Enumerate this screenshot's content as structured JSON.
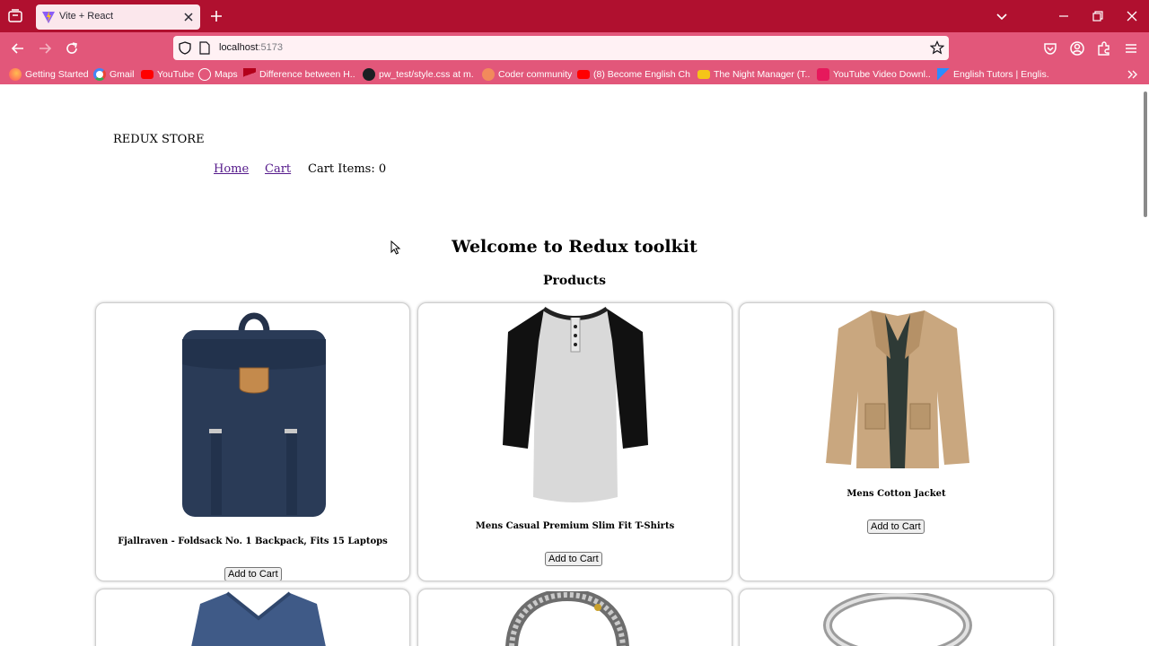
{
  "browser": {
    "tab_title": "Vite + React",
    "url_host": "localhost",
    "url_port": ":5173",
    "colors": {
      "tabbar": "#b0102f",
      "toolbar": "#e2577a"
    },
    "bookmarks": [
      {
        "label": "Getting Started",
        "icon": "firefox-icon"
      },
      {
        "label": "Gmail",
        "icon": "google-icon"
      },
      {
        "label": "YouTube",
        "icon": "youtube-icon"
      },
      {
        "label": "Maps",
        "icon": "globe-icon"
      },
      {
        "label": "Difference between H...",
        "icon": "vue-icon"
      },
      {
        "label": "pw_test/style.css at m...",
        "icon": "github-icon"
      },
      {
        "label": "Coder community",
        "icon": "community-icon"
      },
      {
        "label": "(8) Become English Ch...",
        "icon": "youtube-icon"
      },
      {
        "label": "The Night Manager (T...",
        "icon": "imdb-icon"
      },
      {
        "label": "YouTube Video Downl...",
        "icon": "downloader-icon"
      },
      {
        "label": "English Tutors | Englis...",
        "icon": "tutor-icon"
      }
    ]
  },
  "page": {
    "brand": "REDUX STORE",
    "nav": {
      "home": "Home",
      "cart": "Cart",
      "cart_items": "Cart Items: 0"
    },
    "heading": "Welcome to Redux toolkit",
    "subheading": "Products",
    "products": [
      {
        "title": "Fjallraven - Foldsack No. 1 Backpack, Fits 15 Laptops",
        "button": "Add to Cart",
        "image": "backpack-image"
      },
      {
        "title": "Mens Casual Premium Slim Fit T-Shirts",
        "button": "Add to Cart",
        "image": "tshirt-image"
      },
      {
        "title": "Mens Cotton Jacket",
        "button": "Add to Cart",
        "image": "jacket-image"
      },
      {
        "image": "sweater-image"
      },
      {
        "image": "bracelet-image"
      },
      {
        "image": "ring-image"
      }
    ]
  }
}
